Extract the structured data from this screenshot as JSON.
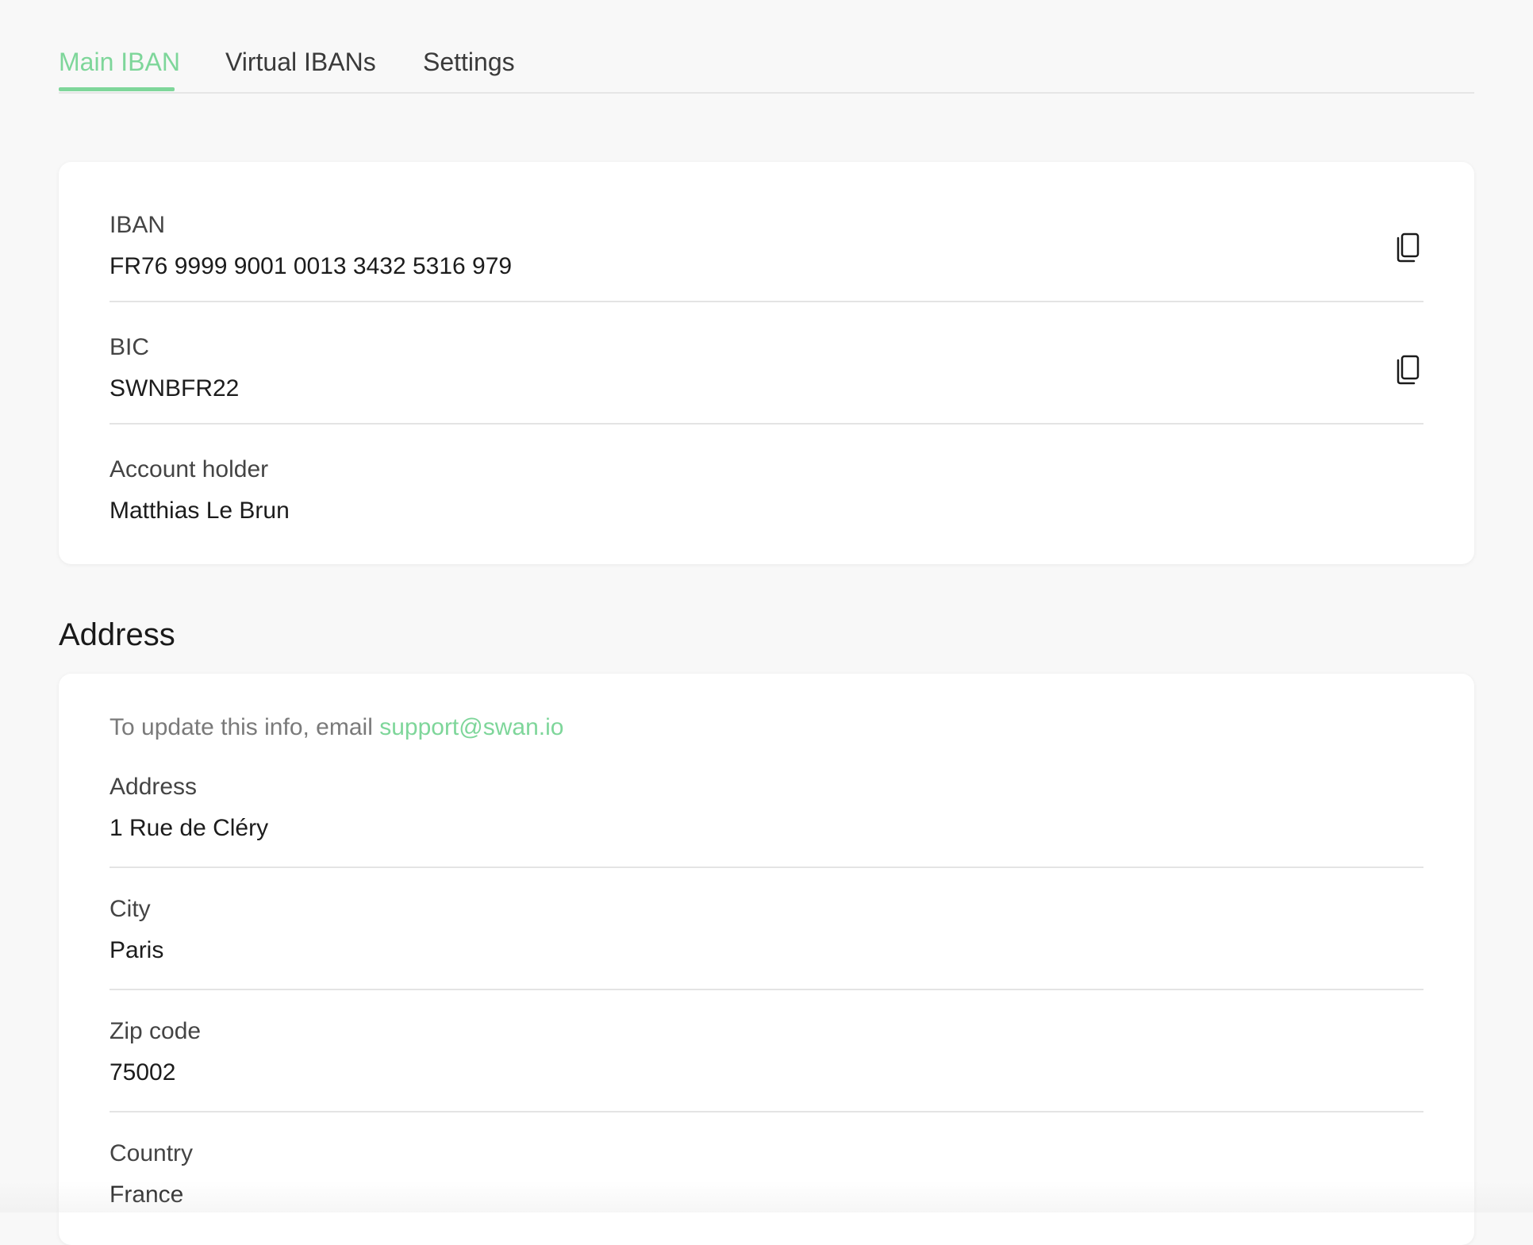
{
  "tabs": [
    {
      "label": "Main IBAN",
      "active": true
    },
    {
      "label": "Virtual IBANs",
      "active": false
    },
    {
      "label": "Settings",
      "active": false
    }
  ],
  "account": {
    "iban": {
      "label": "IBAN",
      "value": "FR76 9999 9001 0013 3432 5316 979",
      "icon": "copy-icon"
    },
    "bic": {
      "label": "BIC",
      "value": "SWNBFR22",
      "icon": "copy-icon"
    },
    "holder": {
      "label": "Account holder",
      "value": "Matthias Le Brun"
    }
  },
  "address_section": {
    "title": "Address",
    "helper_text": "To update this info, email ",
    "support_email": "support@swan.io",
    "fields": [
      {
        "label": "Address",
        "value": "1 Rue de Cléry"
      },
      {
        "label": "City",
        "value": "Paris"
      },
      {
        "label": "Zip code",
        "value": "75002"
      },
      {
        "label": "Country",
        "value": "France"
      }
    ]
  },
  "colors": {
    "accent": "#7ed69a",
    "background": "#f8f8f8",
    "card": "#ffffff",
    "divider": "#e4e4e4"
  }
}
